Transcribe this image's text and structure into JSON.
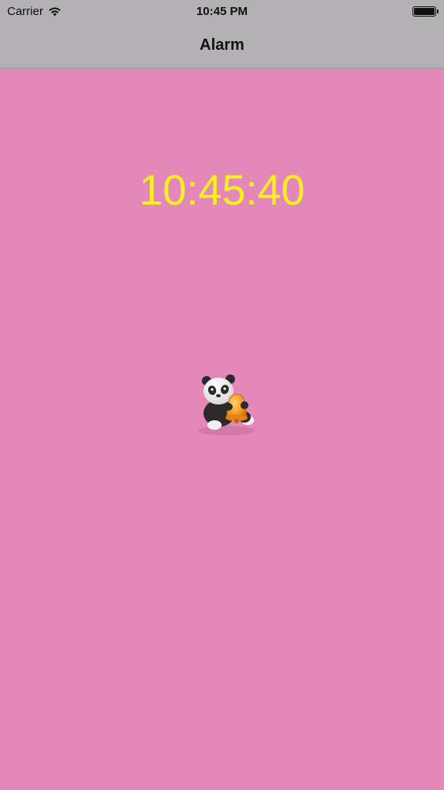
{
  "status_bar": {
    "carrier": "Carrier",
    "time": "10:45 PM",
    "battery_level_percent": 100,
    "wifi_icon": "wifi-icon",
    "battery_icon": "battery-icon"
  },
  "nav": {
    "title": "Alarm"
  },
  "main": {
    "clock_time": "10:45:40",
    "clock_color": "#f7f01f",
    "background_color": "#e388b8",
    "mascot_icon": "panda-with-bell-icon"
  }
}
